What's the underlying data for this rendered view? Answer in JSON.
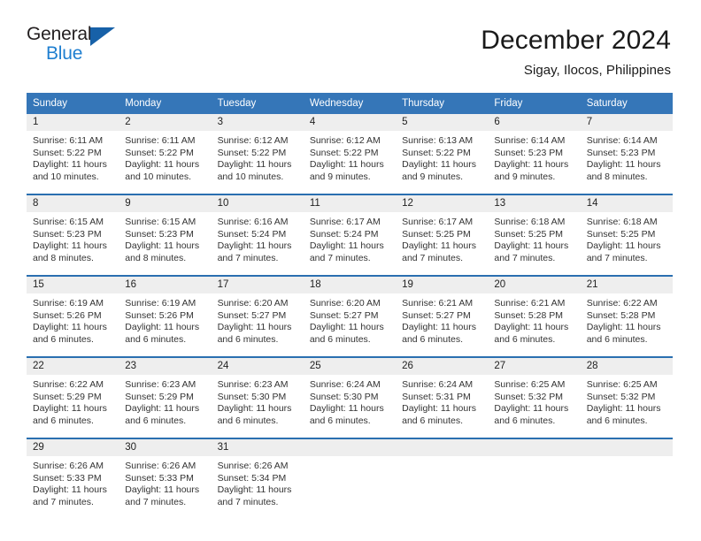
{
  "brand": {
    "name_part1": "General",
    "name_part2": "Blue",
    "flag_icon": "triangle-flag-icon"
  },
  "header": {
    "month_title": "December 2024",
    "location": "Sigay, Ilocos, Philippines"
  },
  "colors": {
    "header_blue": "#3576b8",
    "row_divider_blue": "#2a6fb0",
    "day_number_bg": "#eeeeee",
    "brand_blue": "#1f7fd0",
    "flag_blue": "#1761a8"
  },
  "weekdays": [
    "Sunday",
    "Monday",
    "Tuesday",
    "Wednesday",
    "Thursday",
    "Friday",
    "Saturday"
  ],
  "weeks": [
    [
      {
        "day": "1",
        "lines": [
          "Sunrise: 6:11 AM",
          "Sunset: 5:22 PM",
          "Daylight: 11 hours",
          "and 10 minutes."
        ]
      },
      {
        "day": "2",
        "lines": [
          "Sunrise: 6:11 AM",
          "Sunset: 5:22 PM",
          "Daylight: 11 hours",
          "and 10 minutes."
        ]
      },
      {
        "day": "3",
        "lines": [
          "Sunrise: 6:12 AM",
          "Sunset: 5:22 PM",
          "Daylight: 11 hours",
          "and 10 minutes."
        ]
      },
      {
        "day": "4",
        "lines": [
          "Sunrise: 6:12 AM",
          "Sunset: 5:22 PM",
          "Daylight: 11 hours",
          "and 9 minutes."
        ]
      },
      {
        "day": "5",
        "lines": [
          "Sunrise: 6:13 AM",
          "Sunset: 5:22 PM",
          "Daylight: 11 hours",
          "and 9 minutes."
        ]
      },
      {
        "day": "6",
        "lines": [
          "Sunrise: 6:14 AM",
          "Sunset: 5:23 PM",
          "Daylight: 11 hours",
          "and 9 minutes."
        ]
      },
      {
        "day": "7",
        "lines": [
          "Sunrise: 6:14 AM",
          "Sunset: 5:23 PM",
          "Daylight: 11 hours",
          "and 8 minutes."
        ]
      }
    ],
    [
      {
        "day": "8",
        "lines": [
          "Sunrise: 6:15 AM",
          "Sunset: 5:23 PM",
          "Daylight: 11 hours",
          "and 8 minutes."
        ]
      },
      {
        "day": "9",
        "lines": [
          "Sunrise: 6:15 AM",
          "Sunset: 5:23 PM",
          "Daylight: 11 hours",
          "and 8 minutes."
        ]
      },
      {
        "day": "10",
        "lines": [
          "Sunrise: 6:16 AM",
          "Sunset: 5:24 PM",
          "Daylight: 11 hours",
          "and 7 minutes."
        ]
      },
      {
        "day": "11",
        "lines": [
          "Sunrise: 6:17 AM",
          "Sunset: 5:24 PM",
          "Daylight: 11 hours",
          "and 7 minutes."
        ]
      },
      {
        "day": "12",
        "lines": [
          "Sunrise: 6:17 AM",
          "Sunset: 5:25 PM",
          "Daylight: 11 hours",
          "and 7 minutes."
        ]
      },
      {
        "day": "13",
        "lines": [
          "Sunrise: 6:18 AM",
          "Sunset: 5:25 PM",
          "Daylight: 11 hours",
          "and 7 minutes."
        ]
      },
      {
        "day": "14",
        "lines": [
          "Sunrise: 6:18 AM",
          "Sunset: 5:25 PM",
          "Daylight: 11 hours",
          "and 7 minutes."
        ]
      }
    ],
    [
      {
        "day": "15",
        "lines": [
          "Sunrise: 6:19 AM",
          "Sunset: 5:26 PM",
          "Daylight: 11 hours",
          "and 6 minutes."
        ]
      },
      {
        "day": "16",
        "lines": [
          "Sunrise: 6:19 AM",
          "Sunset: 5:26 PM",
          "Daylight: 11 hours",
          "and 6 minutes."
        ]
      },
      {
        "day": "17",
        "lines": [
          "Sunrise: 6:20 AM",
          "Sunset: 5:27 PM",
          "Daylight: 11 hours",
          "and 6 minutes."
        ]
      },
      {
        "day": "18",
        "lines": [
          "Sunrise: 6:20 AM",
          "Sunset: 5:27 PM",
          "Daylight: 11 hours",
          "and 6 minutes."
        ]
      },
      {
        "day": "19",
        "lines": [
          "Sunrise: 6:21 AM",
          "Sunset: 5:27 PM",
          "Daylight: 11 hours",
          "and 6 minutes."
        ]
      },
      {
        "day": "20",
        "lines": [
          "Sunrise: 6:21 AM",
          "Sunset: 5:28 PM",
          "Daylight: 11 hours",
          "and 6 minutes."
        ]
      },
      {
        "day": "21",
        "lines": [
          "Sunrise: 6:22 AM",
          "Sunset: 5:28 PM",
          "Daylight: 11 hours",
          "and 6 minutes."
        ]
      }
    ],
    [
      {
        "day": "22",
        "lines": [
          "Sunrise: 6:22 AM",
          "Sunset: 5:29 PM",
          "Daylight: 11 hours",
          "and 6 minutes."
        ]
      },
      {
        "day": "23",
        "lines": [
          "Sunrise: 6:23 AM",
          "Sunset: 5:29 PM",
          "Daylight: 11 hours",
          "and 6 minutes."
        ]
      },
      {
        "day": "24",
        "lines": [
          "Sunrise: 6:23 AM",
          "Sunset: 5:30 PM",
          "Daylight: 11 hours",
          "and 6 minutes."
        ]
      },
      {
        "day": "25",
        "lines": [
          "Sunrise: 6:24 AM",
          "Sunset: 5:30 PM",
          "Daylight: 11 hours",
          "and 6 minutes."
        ]
      },
      {
        "day": "26",
        "lines": [
          "Sunrise: 6:24 AM",
          "Sunset: 5:31 PM",
          "Daylight: 11 hours",
          "and 6 minutes."
        ]
      },
      {
        "day": "27",
        "lines": [
          "Sunrise: 6:25 AM",
          "Sunset: 5:32 PM",
          "Daylight: 11 hours",
          "and 6 minutes."
        ]
      },
      {
        "day": "28",
        "lines": [
          "Sunrise: 6:25 AM",
          "Sunset: 5:32 PM",
          "Daylight: 11 hours",
          "and 6 minutes."
        ]
      }
    ],
    [
      {
        "day": "29",
        "lines": [
          "Sunrise: 6:26 AM",
          "Sunset: 5:33 PM",
          "Daylight: 11 hours",
          "and 7 minutes."
        ]
      },
      {
        "day": "30",
        "lines": [
          "Sunrise: 6:26 AM",
          "Sunset: 5:33 PM",
          "Daylight: 11 hours",
          "and 7 minutes."
        ]
      },
      {
        "day": "31",
        "lines": [
          "Sunrise: 6:26 AM",
          "Sunset: 5:34 PM",
          "Daylight: 11 hours",
          "and 7 minutes."
        ]
      },
      {
        "day": "",
        "lines": []
      },
      {
        "day": "",
        "lines": []
      },
      {
        "day": "",
        "lines": []
      },
      {
        "day": "",
        "lines": []
      }
    ]
  ]
}
